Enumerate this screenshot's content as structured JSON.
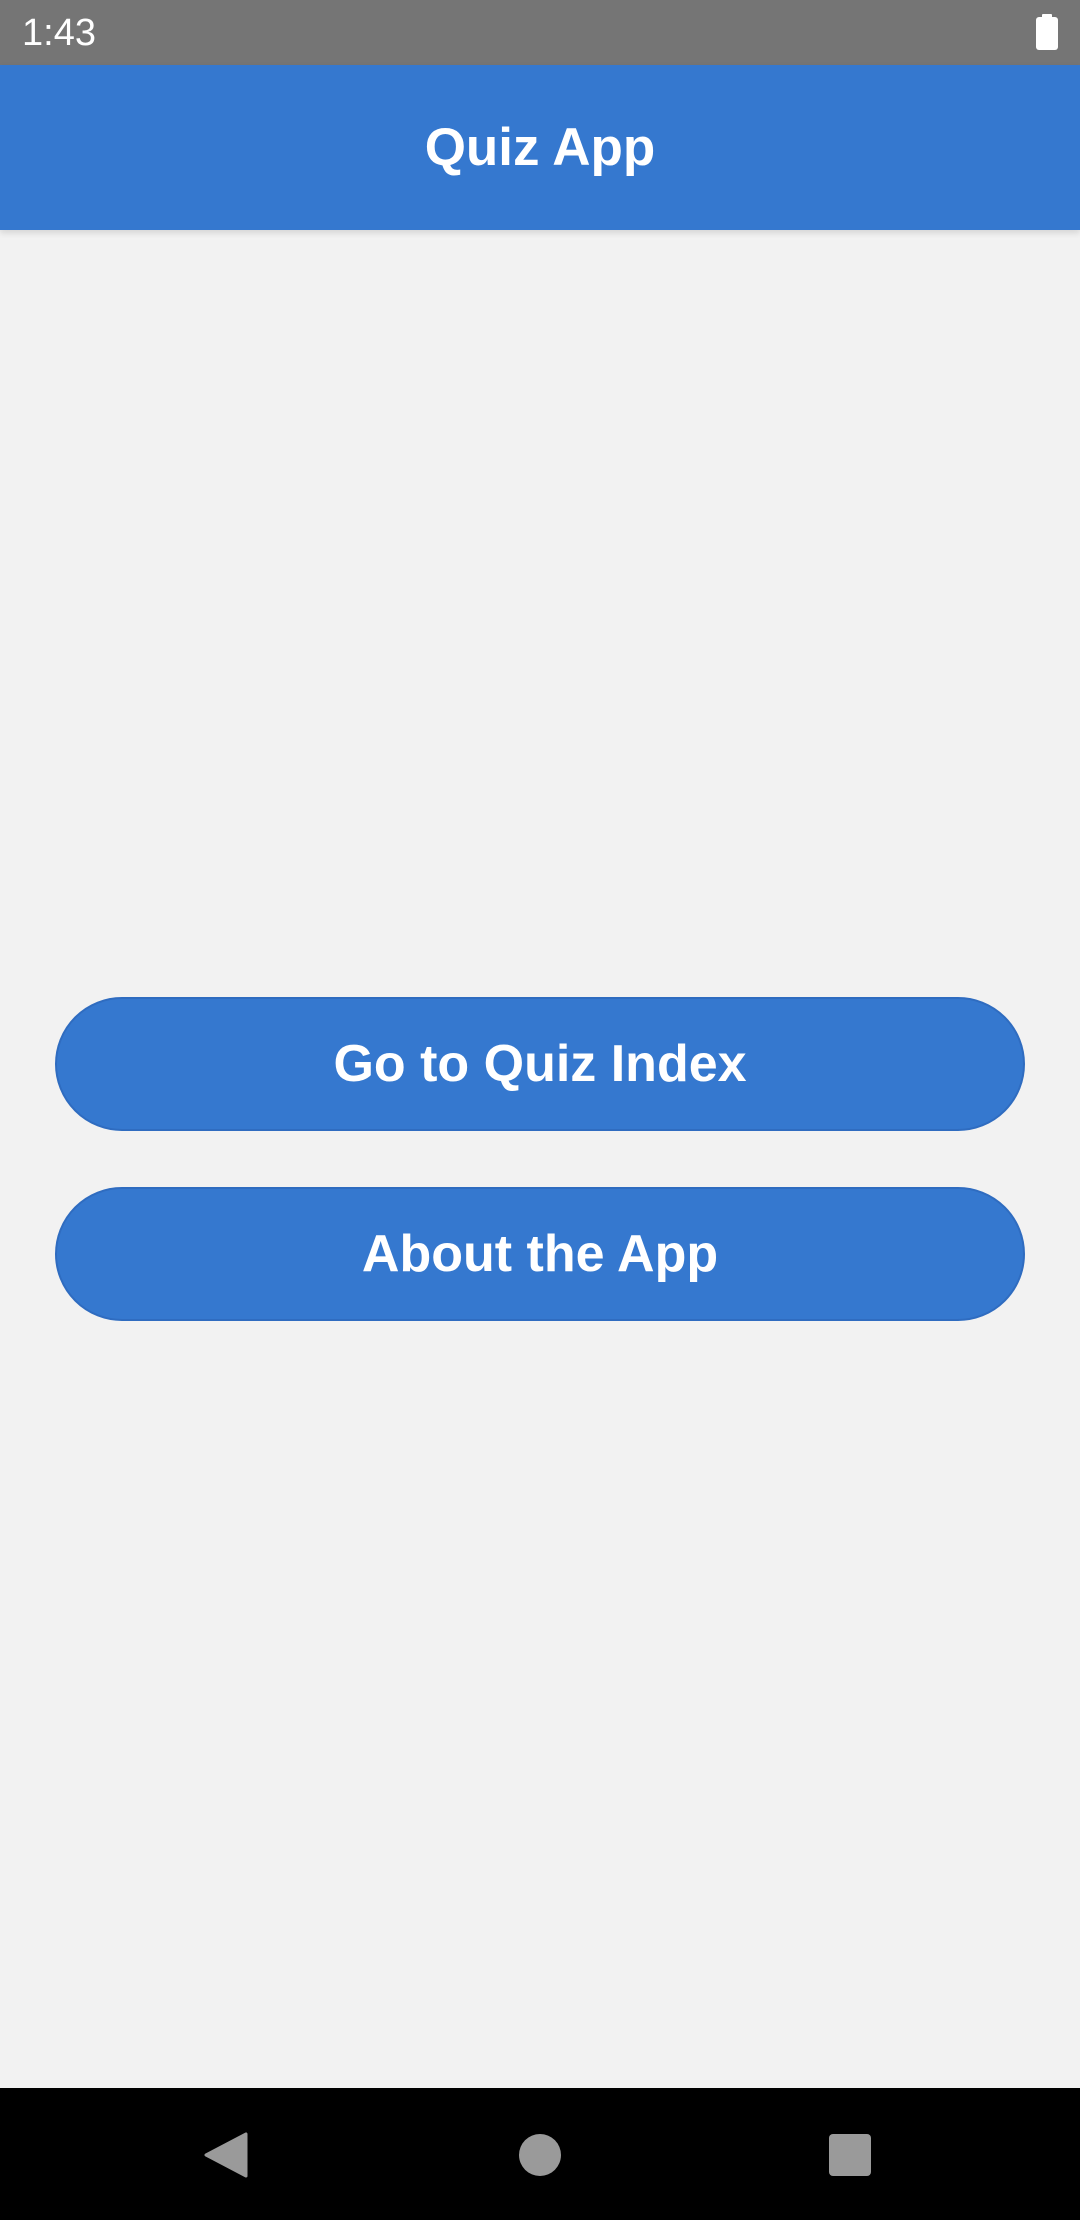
{
  "status_bar": {
    "time": "1:43",
    "battery_icon": "battery-full-icon"
  },
  "app_bar": {
    "title": "Quiz App"
  },
  "main": {
    "buttons": [
      {
        "label": "Go to Quiz Index"
      },
      {
        "label": "About the App"
      }
    ]
  },
  "nav_bar": {
    "back_icon": "back-triangle-icon",
    "home_icon": "home-circle-icon",
    "recents_icon": "recents-square-icon"
  },
  "colors": {
    "primary": "#3578cf",
    "background": "#f2f2f2",
    "status_bar": "#757575",
    "nav_bar": "#000000"
  }
}
